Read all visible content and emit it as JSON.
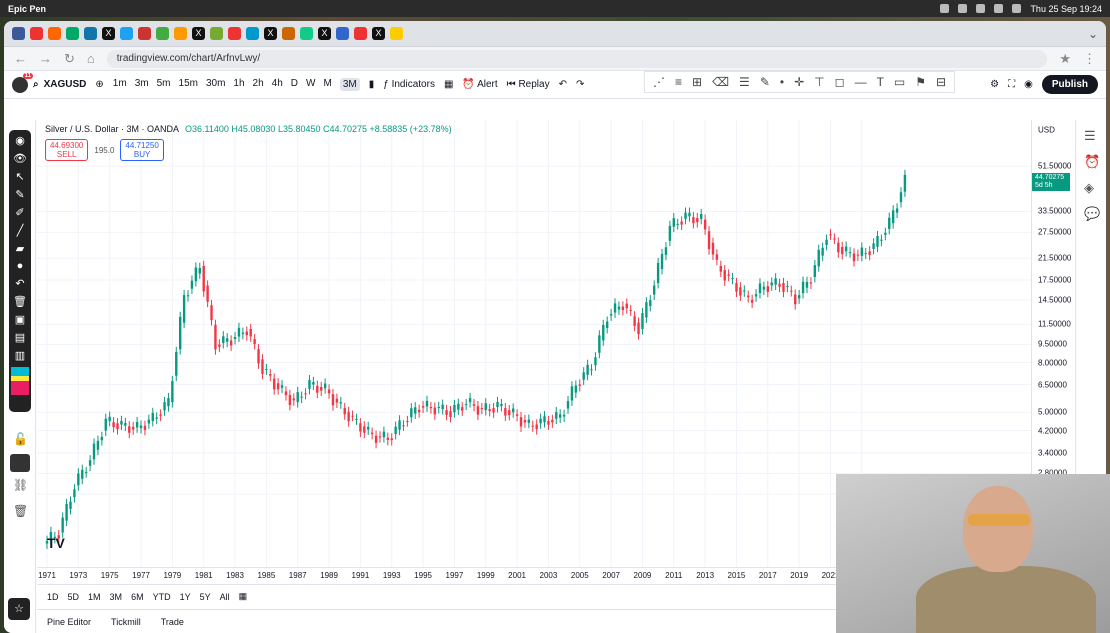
{
  "menubar": {
    "app": "Epic Pen",
    "datetime": "Thu 25 Sep  19:24"
  },
  "browser": {
    "url": "tradingview.com/chart/ArfnvLwy/",
    "tab_close": "×"
  },
  "toolbar": {
    "symbol": "XAGUSD",
    "avatar_badge": "11",
    "timeframes": [
      "1m",
      "3m",
      "5m",
      "15m",
      "30m",
      "1h",
      "2h",
      "4h",
      "D",
      "W",
      "M",
      "3M"
    ],
    "active_timeframe": "3M",
    "indicators": "Indicators",
    "alert": "Alert",
    "replay": "Replay",
    "publish": "Publish"
  },
  "legend": {
    "title": "Silver / U.S. Dollar · 3M · OANDA",
    "values": "O36.11400 H45.08030 L35.80450 C44.70275 +8.58835 (+23.78%)",
    "sell_price": "44.69300",
    "sell_label": "SELL",
    "spread": "195.0",
    "buy_price": "44.71250",
    "buy_label": "BUY"
  },
  "yaxis": {
    "currency": "USD",
    "labels": [
      "51.50000",
      "33.50000",
      "27.50000",
      "21.50000",
      "17.50000",
      "14.50000",
      "11.50000",
      "9.50000",
      "8.00000",
      "6.50000",
      "5.00000",
      "4.20000",
      "3.40000",
      "2.80000",
      "2.30000"
    ],
    "last_price": "44.70275",
    "countdown": "5d 5h"
  },
  "xaxis": {
    "labels": [
      "1971",
      "1973",
      "1975",
      "1977",
      "1979",
      "1981",
      "1983",
      "1985",
      "1987",
      "1989",
      "1991",
      "1993",
      "1995",
      "1997",
      "1999",
      "2001",
      "2003",
      "2005",
      "2007",
      "2009",
      "2011",
      "2013",
      "2015",
      "2017",
      "2019",
      "2021",
      "202"
    ]
  },
  "ranges": [
    "1D",
    "5D",
    "1M",
    "3M",
    "6M",
    "YTD",
    "1Y",
    "5Y",
    "All"
  ],
  "bottom_tabs": [
    "Pine Editor",
    "Tickmill",
    "Trade"
  ],
  "colors": {
    "up": "#089981",
    "down": "#f23645",
    "accent": "#2962ff"
  },
  "chart_data": {
    "type": "candlestick",
    "symbol": "XAGUSD",
    "interval": "3M",
    "scale": "log",
    "ylim": [
      1.8,
      60
    ],
    "x": [
      1971,
      1972,
      1973,
      1974,
      1975,
      1976,
      1977,
      1978,
      1979,
      1980,
      1981,
      1982,
      1983,
      1984,
      1985,
      1986,
      1987,
      1988,
      1989,
      1990,
      1991,
      1992,
      1993,
      1994,
      1995,
      1996,
      1997,
      1998,
      1999,
      2000,
      2001,
      2002,
      2003,
      2004,
      2005,
      2006,
      2007,
      2008,
      2009,
      2010,
      2011,
      2012,
      2013,
      2014,
      2015,
      2016,
      2017,
      2018,
      2019,
      2020,
      2021,
      2022,
      2023,
      2024,
      2025
    ],
    "close": [
      1.6,
      2.5,
      3.2,
      4.6,
      4.4,
      4.3,
      4.7,
      5.5,
      15,
      20,
      9.5,
      10,
      11,
      7.5,
      6.3,
      5.5,
      6.5,
      6.2,
      5.2,
      4.5,
      4.0,
      3.9,
      4.6,
      5.3,
      5.2,
      5.0,
      5.5,
      5.1,
      5.3,
      4.9,
      4.4,
      4.6,
      4.8,
      6.5,
      7.8,
      12.5,
      14,
      11,
      17,
      29,
      32,
      31,
      20,
      17,
      14.5,
      16.5,
      17,
      14.7,
      18,
      27,
      23,
      22,
      24,
      30,
      44.70275
    ]
  }
}
